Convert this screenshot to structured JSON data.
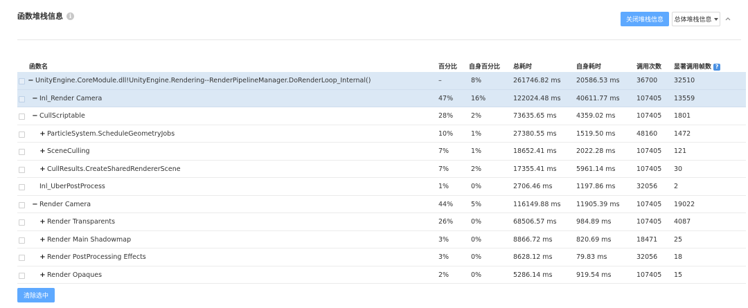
{
  "header": {
    "title": "函数堆栈信息",
    "info_icon": "i",
    "close_stack_button": "关闭堆栈信息",
    "overall_stack_dropdown": "总体堆栈信息"
  },
  "columns": {
    "name": "函数名",
    "percent": "百分比",
    "self_percent": "自身百分比",
    "total_time": "总耗时",
    "self_time": "自身耗时",
    "calls": "调用次数",
    "significant_frames": "显著调用帧数",
    "help_icon": "?"
  },
  "rows": [
    {
      "toggle": "−",
      "name": "UnityEngine.CoreModule.dll!UnityEngine.Rendering--RenderPipelineManager.DoRenderLoop_Internal()",
      "percent": "–",
      "self_percent": "8%",
      "total_time": "261746.82 ms",
      "self_time": "20586.53 ms",
      "calls": "36700",
      "sig": "32510",
      "selected": true
    },
    {
      "toggle": "−",
      "name": "Inl_Render Camera",
      "percent": "47%",
      "self_percent": "16%",
      "total_time": "122024.48 ms",
      "self_time": "40611.77 ms",
      "calls": "107405",
      "sig": "13559",
      "selected": true
    },
    {
      "toggle": "−",
      "name": "CullScriptable",
      "percent": "28%",
      "self_percent": "2%",
      "total_time": "73635.65 ms",
      "self_time": "4359.02 ms",
      "calls": "107405",
      "sig": "1801",
      "selected": false
    },
    {
      "toggle": "+",
      "name": "ParticleSystem.ScheduleGeometryJobs",
      "percent": "10%",
      "self_percent": "1%",
      "total_time": "27380.55 ms",
      "self_time": "1519.50 ms",
      "calls": "48160",
      "sig": "1472",
      "selected": false
    },
    {
      "toggle": "+",
      "name": "SceneCulling",
      "percent": "7%",
      "self_percent": "1%",
      "total_time": "18652.41 ms",
      "self_time": "2022.28 ms",
      "calls": "107405",
      "sig": "121",
      "selected": false
    },
    {
      "toggle": "+",
      "name": "CullResults.CreateSharedRendererScene",
      "percent": "7%",
      "self_percent": "2%",
      "total_time": "17355.41 ms",
      "self_time": "5961.14 ms",
      "calls": "107405",
      "sig": "30",
      "selected": false
    },
    {
      "toggle": "",
      "name": "Inl_UberPostProcess",
      "percent": "1%",
      "self_percent": "0%",
      "total_time": "2706.46 ms",
      "self_time": "1197.86 ms",
      "calls": "32056",
      "sig": "2",
      "selected": false
    },
    {
      "toggle": "−",
      "name": "Render Camera",
      "percent": "44%",
      "self_percent": "5%",
      "total_time": "116149.88 ms",
      "self_time": "11905.39 ms",
      "calls": "107405",
      "sig": "19022",
      "selected": false
    },
    {
      "toggle": "+",
      "name": "Render Transparents",
      "percent": "26%",
      "self_percent": "0%",
      "total_time": "68506.57 ms",
      "self_time": "984.89 ms",
      "calls": "107405",
      "sig": "4087",
      "selected": false
    },
    {
      "toggle": "+",
      "name": "Render Main Shadowmap",
      "percent": "3%",
      "self_percent": "0%",
      "total_time": "8866.72 ms",
      "self_time": "820.69 ms",
      "calls": "18471",
      "sig": "25",
      "selected": false
    },
    {
      "toggle": "+",
      "name": "Render PostProcessing Effects",
      "percent": "3%",
      "self_percent": "0%",
      "total_time": "8628.12 ms",
      "self_time": "79.83 ms",
      "calls": "32056",
      "sig": "18",
      "selected": false
    },
    {
      "toggle": "+",
      "name": "Render Opaques",
      "percent": "2%",
      "self_percent": "0%",
      "total_time": "5286.14 ms",
      "self_time": "919.54 ms",
      "calls": "107405",
      "sig": "15",
      "selected": false
    }
  ],
  "footer": {
    "clear_selection_button": "清除选中"
  },
  "colors": {
    "accent": "#5ea9ff",
    "selected_row": "#dbe8f5",
    "help_icon": "#4a90e2"
  }
}
